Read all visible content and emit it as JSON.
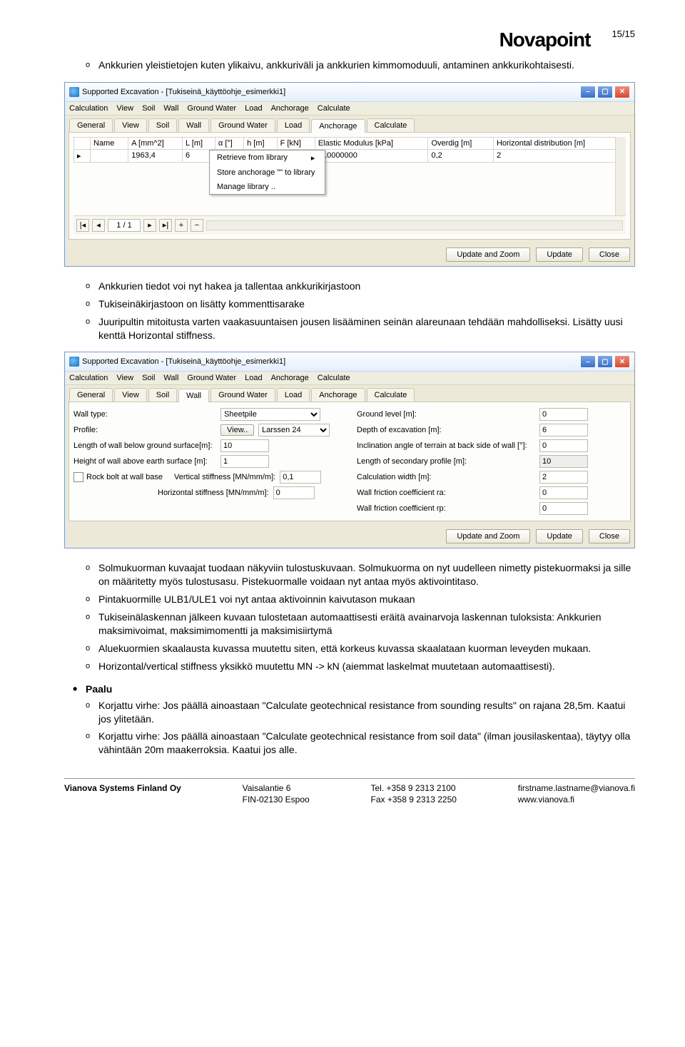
{
  "header": {
    "logo": "Novapoint",
    "pagenum": "15/15"
  },
  "intro_item": "Ankkurien yleistietojen kuten ylikaivu, ankkuriväli ja ankkurien kimmomoduuli, antaminen ankkurikohtaisesti.",
  "win1": {
    "title": "Supported Excavation - [Tukiseinä_käyttöohje_esimerkki1]",
    "menu": [
      "Calculation",
      "View",
      "Soil",
      "Wall",
      "Ground Water",
      "Load",
      "Anchorage",
      "Calculate"
    ],
    "tabs": [
      "General",
      "View",
      "Soil",
      "Wall",
      "Ground Water",
      "Load",
      "Anchorage",
      "Calculate"
    ],
    "active_tab": "Anchorage",
    "cols": [
      "Name",
      "A [mm^2]",
      "L [m]",
      "α [°]",
      "h [m]",
      "F [kN]",
      "Elastic Modulus [kPa]",
      "Overdig [m]",
      "Horizontal distribution [m]"
    ],
    "row": [
      "",
      "1963,4",
      "6",
      "",
      "",
      "",
      "210000000",
      "0,2",
      "2"
    ],
    "ctx": [
      "Retrieve from library",
      "Store anchorage \"\" to library",
      "Manage library .."
    ],
    "ctx_arrow": "▸",
    "pager": "1 / 1",
    "btns": {
      "uz": "Update and Zoom",
      "u": "Update",
      "c": "Close"
    }
  },
  "mid_items": [
    "Ankkurien tiedot voi nyt hakea ja tallentaa ankkurikirjastoon",
    "Tukiseinäkirjastoon on lisätty kommenttisarake",
    "Juuripultin mitoitusta varten vaakasuuntaisen jousen lisääminen seinän alareunaan tehdään mahdolliseksi. Lisätty uusi kenttä Horizontal stiffness."
  ],
  "win2": {
    "title": "Supported Excavation - [Tukiseinä_käyttöohje_esimerkki1]",
    "menu": [
      "Calculation",
      "View",
      "Soil",
      "Wall",
      "Ground Water",
      "Load",
      "Anchorage",
      "Calculate"
    ],
    "tabs": [
      "General",
      "View",
      "Soil",
      "Wall",
      "Ground Water",
      "Load",
      "Anchorage",
      "Calculate"
    ],
    "active_tab": "Wall",
    "left": {
      "wall_type_lbl": "Wall type:",
      "wall_type": "Sheetpile",
      "profile_lbl": "Profile:",
      "profile_btn": "View..",
      "profile": "Larssen 24",
      "len_lbl": "Length of wall below ground surface[m]:",
      "len": "10",
      "hgt_lbl": "Height of wall above earth surface [m]:",
      "hgt": "1",
      "rock_lbl": "Rock bolt at wall base",
      "vstiff_lbl": "Vertical stiffness [MN/mm/m]:",
      "vstiff": "0,1",
      "hstiff_lbl": "Horizontal stiffness [MN/mm/m]:",
      "hstiff": "0"
    },
    "right": {
      "gl_lbl": "Ground level [m]:",
      "gl": "0",
      "de_lbl": "Depth of excavation [m]:",
      "de": "6",
      "inc_lbl": "Inclination angle of terrain at back side of wall [°]:",
      "inc": "0",
      "lsp_lbl": "Length of secondary profile [m]:",
      "lsp": "10",
      "cw_lbl": "Calculation width [m]:",
      "cw": "2",
      "ra_lbl": "Wall friction coefficient ra:",
      "ra": "0",
      "rp_lbl": "Wall friction coefficient rp:",
      "rp": "0"
    },
    "btns": {
      "uz": "Update and Zoom",
      "u": "Update",
      "c": "Close"
    }
  },
  "after_items": [
    "Solmukuorman kuvaajat tuodaan näkyviin tulostuskuvaan. Solmukuorma on nyt uudelleen nimetty pistekuormaksi ja sille on määritetty myös tulostusasu. Pistekuormalle voidaan nyt antaa myös aktivointitaso.",
    "Pintakuormille ULB1/ULE1 voi nyt antaa aktivoinnin kaivutason mukaan",
    "Tukiseinälaskennan jälkeen kuvaan tulostetaan automaattisesti eräitä avainarvoja laskennan tuloksista: Ankkurien maksimivoimat, maksimimomentti ja maksimisiirtymä",
    "Aluekuormien skaalausta kuvassa muutettu siten, että korkeus kuvassa skaalataan kuorman leveyden mukaan.",
    "Horizontal/vertical stiffness yksikkö muutettu MN -> kN (aiemmat laskelmat muutetaan automaattisesti)."
  ],
  "paalu_head": "Paalu",
  "paalu_items": [
    "Korjattu virhe: Jos päällä ainoastaan \"Calculate geotechnical resistance from sounding results\" on rajana 28,5m. Kaatui jos ylitetään.",
    "Korjattu virhe: Jos päällä ainoastaan \"Calculate geotechnical resistance from soil data\" (ilman jousilaskentaa), täytyy olla vähintään 20m maakerroksia. Kaatui jos alle."
  ],
  "footer": {
    "c1a": "Vianova Systems Finland Oy",
    "c1b": "",
    "c2a": "Vaisalantie 6",
    "c2b": "FIN-02130 Espoo",
    "c3a": "Tel. +358 9 2313 2100",
    "c3b": "Fax +358 9 2313 2250",
    "c4a": "firstname.lastname@vianova.fi",
    "c4b": "www.vianova.fi"
  }
}
